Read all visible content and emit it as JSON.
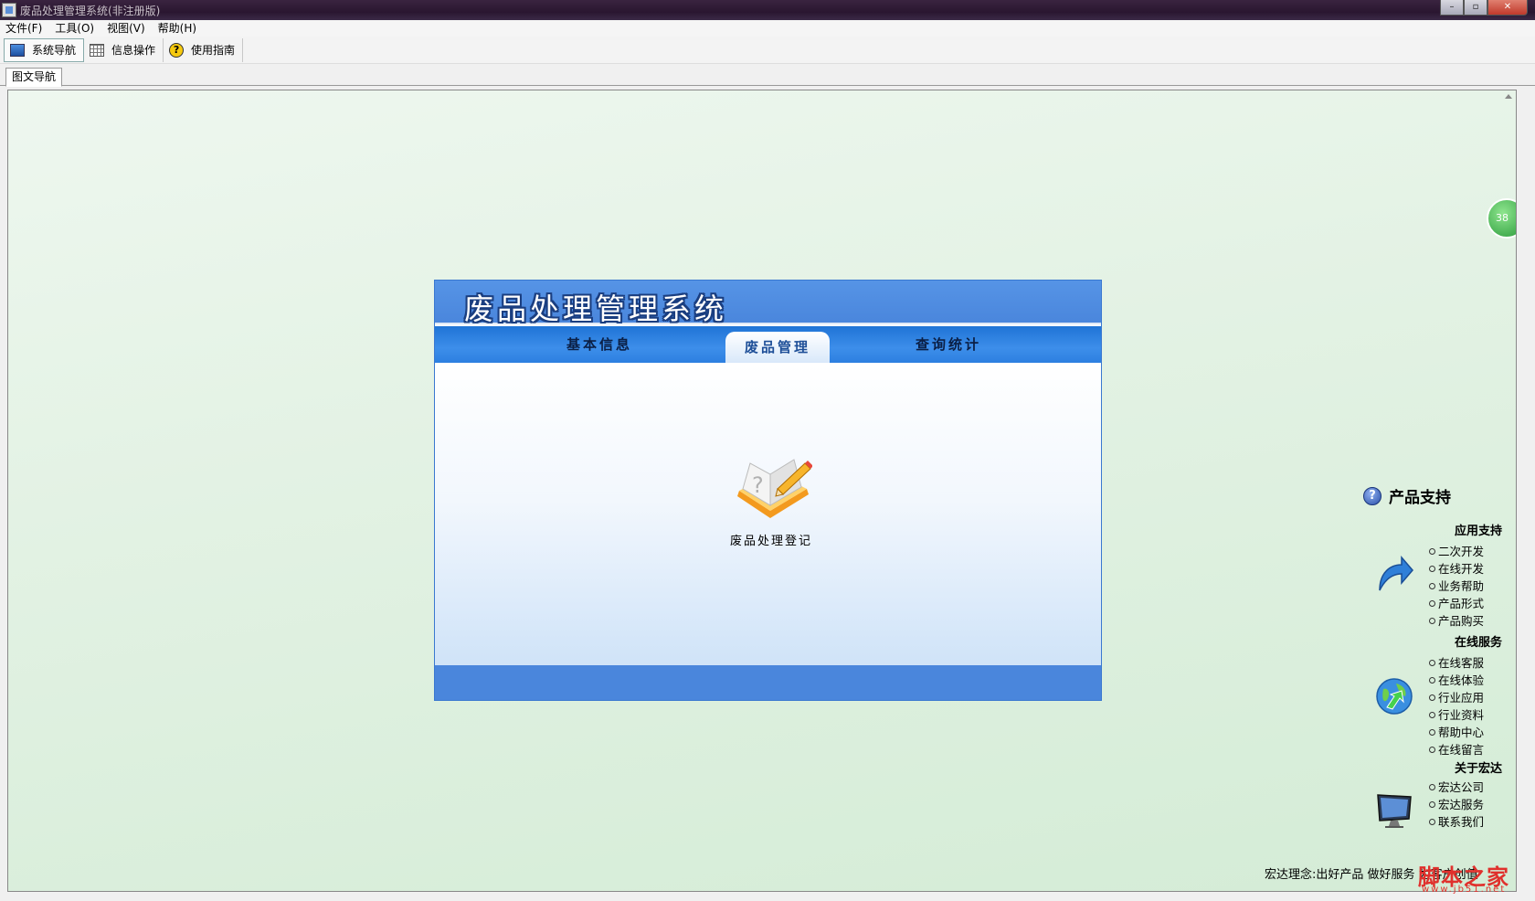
{
  "window": {
    "title": "废品处理管理系统(非注册版)",
    "minimize": "–",
    "maximize": "▫",
    "close": "✕"
  },
  "menu": [
    "文件(F)",
    "工具(O)",
    "视图(V)",
    "帮助(H)"
  ],
  "toolbar": {
    "nav_label": "系统导航",
    "info_label": "信息操作",
    "guide_label": "使用指南",
    "help_glyph": "?"
  },
  "doc_tab": "图文导航",
  "float_badge": "38",
  "panel": {
    "title": "废品处理管理系统",
    "tabs": [
      "基本信息",
      "废品管理",
      "查询统计"
    ],
    "active_tab": "废品管理",
    "item_label": "废品处理登记"
  },
  "support": {
    "title": "产品支持",
    "help_glyph": "?",
    "sections": [
      {
        "title": "应用支持",
        "icon": "arrow-return-icon",
        "links": [
          "二次开发",
          "在线开发",
          "业务帮助",
          "产品形式",
          "产品购买"
        ]
      },
      {
        "title": "在线服务",
        "icon": "globe-icon",
        "links": [
          "在线客服",
          "在线体验",
          "行业应用",
          "行业资料",
          "帮助中心",
          "在线留言"
        ]
      },
      {
        "title": "关于宏达",
        "icon": "monitor-icon",
        "links": [
          "宏达公司",
          "宏达服务",
          "联系我们"
        ]
      }
    ]
  },
  "slogan": "宏达理念:出好产品 做好服务 为客户创值",
  "watermark": {
    "text": "脚本之家",
    "sub": "www.jb51.net"
  },
  "colors": {
    "panel_blue": "#4a86dc",
    "tab_active": "#1e4f98",
    "content_bg": "#e3f2e4"
  }
}
